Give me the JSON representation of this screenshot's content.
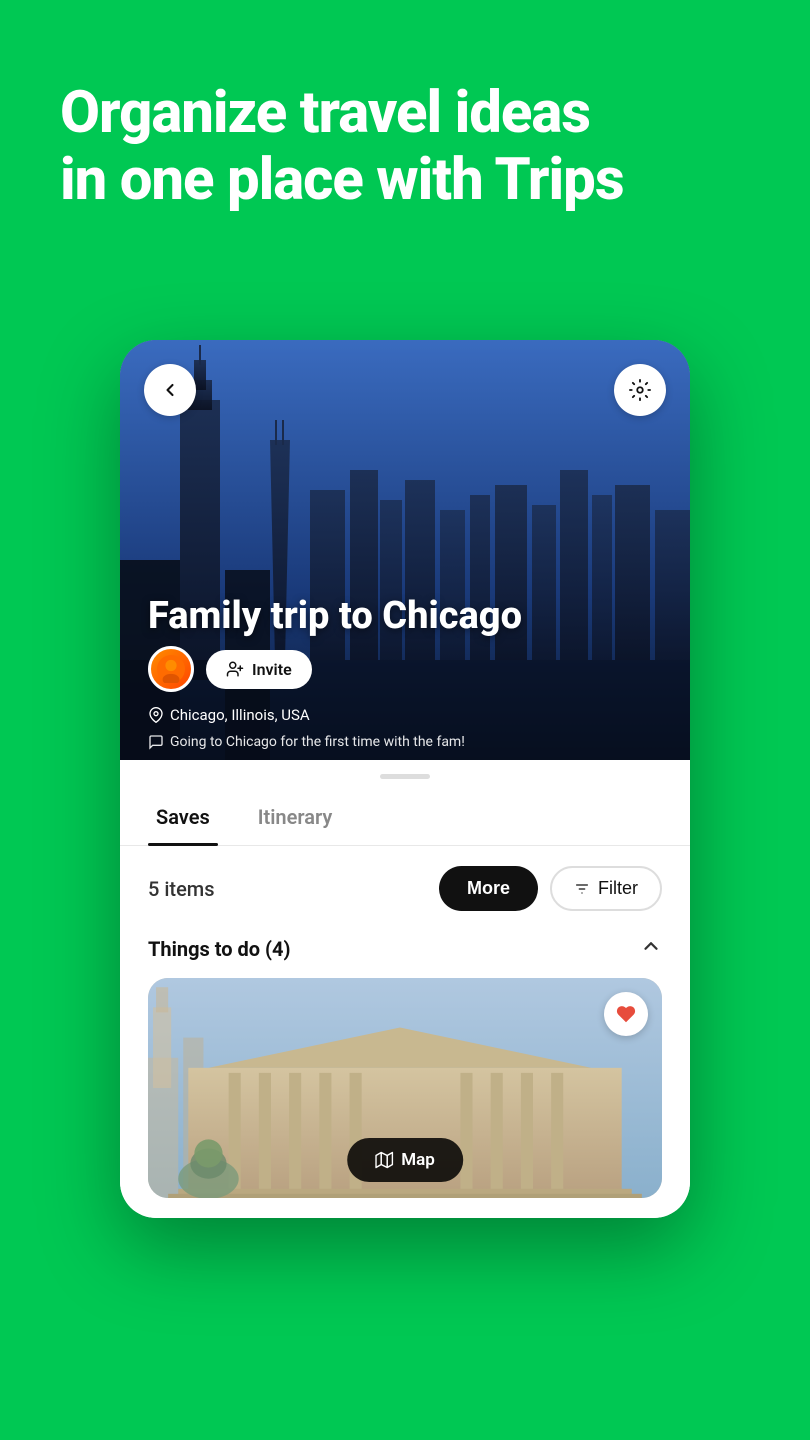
{
  "hero": {
    "headline_line1": "Organize travel ideas",
    "headline_line2": "in one place with Trips"
  },
  "trip": {
    "title": "Family trip to Chicago",
    "location": "Chicago, Illinois, USA",
    "note": "Going to Chicago for the first time with the fam!",
    "invite_label": "Invite"
  },
  "tabs": [
    {
      "id": "saves",
      "label": "Saves",
      "active": true
    },
    {
      "id": "itinerary",
      "label": "Itinerary",
      "active": false
    }
  ],
  "content": {
    "items_count": "5 items",
    "more_button": "More",
    "filter_button": "Filter",
    "section_title": "Things to do (4)"
  },
  "buttons": {
    "back": "‹",
    "settings": "⚙",
    "heart": "♥",
    "map_label": "Map",
    "chevron_up": "∧"
  }
}
